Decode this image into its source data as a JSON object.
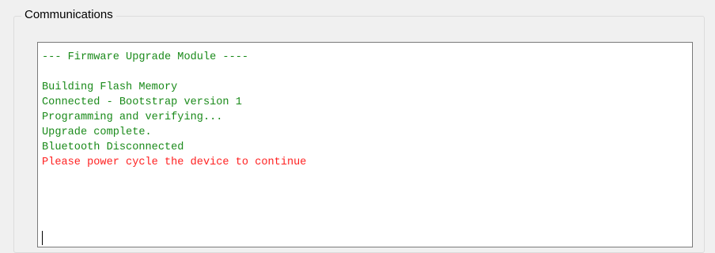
{
  "groupbox": {
    "title": "Communications"
  },
  "console": {
    "lines": [
      {
        "text": "--- Firmware Upgrade Module ----",
        "color": "#1a8a1a"
      },
      {
        "text": "",
        "color": "#1a8a1a"
      },
      {
        "text": "Building Flash Memory",
        "color": "#1a8a1a"
      },
      {
        "text": "Connected - Bootstrap version 1",
        "color": "#1a8a1a"
      },
      {
        "text": "Programming and verifying...",
        "color": "#1a8a1a"
      },
      {
        "text": "Upgrade complete.",
        "color": "#1a8a1a"
      },
      {
        "text": "Bluetooth Disconnected",
        "color": "#1a8a1a"
      },
      {
        "text": "Please power cycle the device to continue",
        "color": "#ff2020"
      }
    ]
  },
  "colors": {
    "window_background": "#f0f0f0",
    "console_background": "#ffffff",
    "log_text": "#1a8a1a",
    "error_text": "#ff2020"
  }
}
